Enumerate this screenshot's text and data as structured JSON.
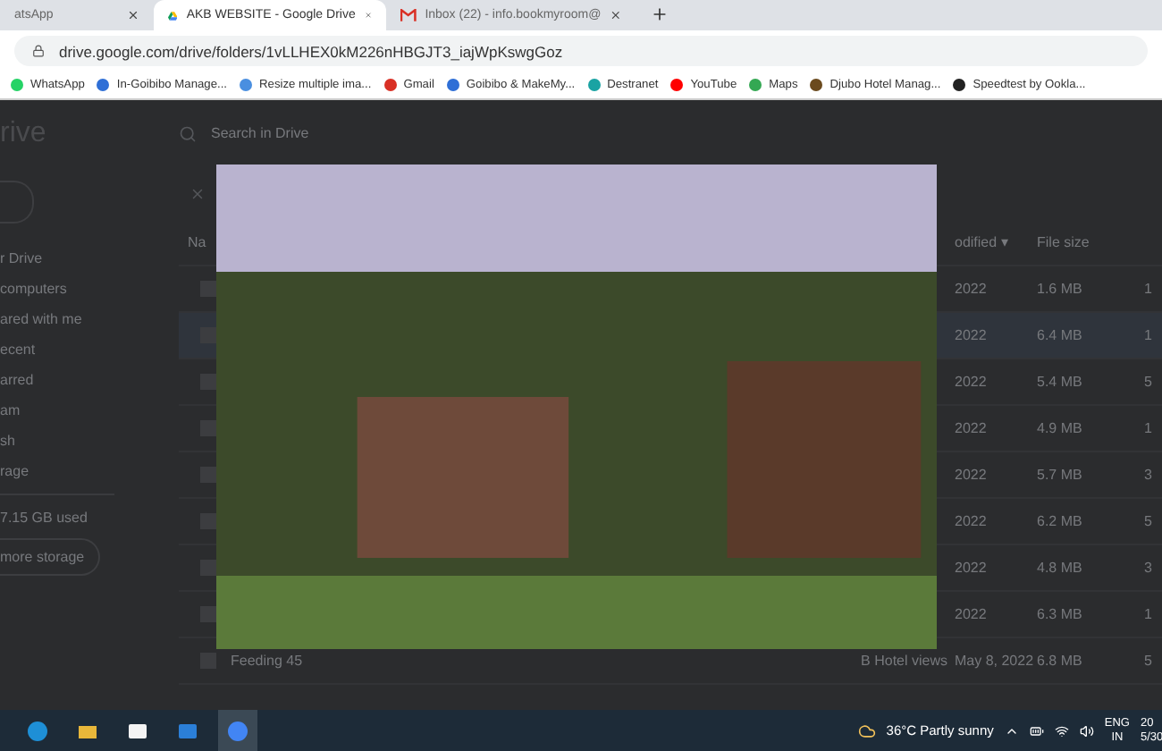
{
  "browser": {
    "tabs": [
      {
        "title": "atsApp",
        "selected": false
      },
      {
        "title": "AKB WEBSITE - Google Drive",
        "selected": true
      },
      {
        "title": "Inbox (22) - info.bookmyroom@",
        "selected": false
      }
    ],
    "address": "drive.google.com/drive/folders/1vLLHEX0kM226nHBGJT3_iajWpKswgGoz",
    "bookmarks": [
      {
        "label": "WhatsApp",
        "color": "#25d366"
      },
      {
        "label": "In-Goibibo Manage...",
        "color": "#2f6fd6"
      },
      {
        "label": "Resize multiple ima...",
        "color": "#4a8fe0"
      },
      {
        "label": "Gmail",
        "color": "#d93025"
      },
      {
        "label": "Goibibo & MakeMy...",
        "color": "#2f6fd6"
      },
      {
        "label": "Destranet",
        "color": "#1aa3a3"
      },
      {
        "label": "YouTube",
        "color": "#ff0000"
      },
      {
        "label": "Maps",
        "color": "#34a853"
      },
      {
        "label": "Djubo Hotel Manag...",
        "color": "#6b4a1e"
      },
      {
        "label": "Speedtest by Ookla...",
        "color": "#222222"
      }
    ]
  },
  "drive": {
    "logo_text": "rive",
    "search_placeholder": "Search in Drive",
    "sidebar": [
      "r Drive",
      "computers",
      "ared with me",
      "ecent",
      "arred",
      "am",
      "sh",
      "rage"
    ],
    "storage": "7.15 GB used",
    "storage_button": "more storage",
    "columns": {
      "name": "Na",
      "modified": "odified ▾",
      "size": "File size"
    },
    "rows": [
      {
        "modified": "2022",
        "size": "1.6 MB",
        "column_4": "1",
        "selected": false
      },
      {
        "modified": "2022",
        "size": "6.4 MB",
        "column_4": "1",
        "selected": true
      },
      {
        "modified": "2022",
        "size": "5.4 MB",
        "column_4": "5",
        "selected": false
      },
      {
        "modified": "2022",
        "size": "4.9 MB",
        "column_4": "1",
        "selected": false
      },
      {
        "modified": "2022",
        "size": "5.7 MB",
        "column_4": "3",
        "selected": false
      },
      {
        "modified": "2022",
        "size": "6.2 MB",
        "column_4": "5",
        "selected": false
      },
      {
        "modified": "2022",
        "size": "4.8 MB",
        "column_4": "3",
        "selected": false
      },
      {
        "modified": "2022",
        "size": "6.3 MB",
        "column_4": "1",
        "selected": false
      },
      {
        "name": "Feeding 45",
        "owner": "B Hotel views",
        "modified": "May 8, 2022",
        "size": "6.8 MB",
        "column_4": "5",
        "selected": false
      }
    ]
  },
  "taskbar": {
    "apps": [
      {
        "kind": "edge",
        "selected": false
      },
      {
        "kind": "folder",
        "selected": false
      },
      {
        "kind": "store",
        "selected": false
      },
      {
        "kind": "mail",
        "selected": false
      },
      {
        "kind": "chrome",
        "selected": true
      }
    ],
    "weather": "36°C  Partly sunny",
    "language": "ENG",
    "region": "IN",
    "time": "20",
    "date": "5/30"
  }
}
